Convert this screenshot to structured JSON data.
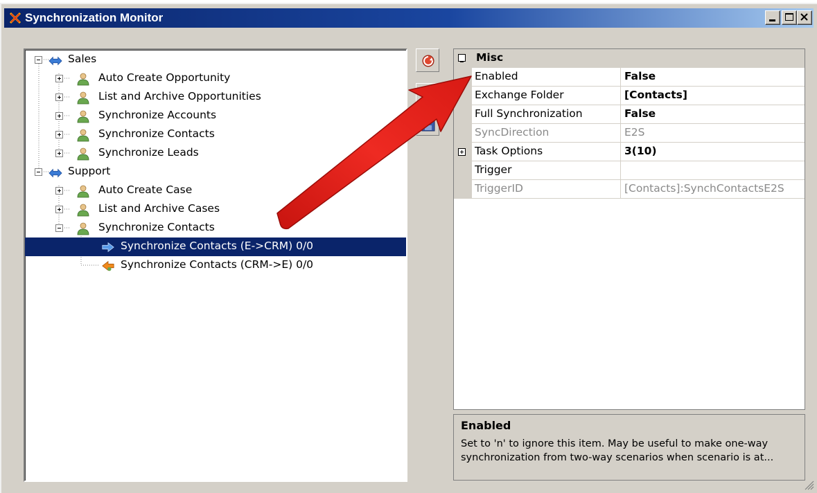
{
  "window": {
    "title": "Synchronization Monitor"
  },
  "tree": {
    "groups": [
      {
        "label": "Sales",
        "items": [
          {
            "label": "Auto Create Opportunity"
          },
          {
            "label": "List and Archive Opportunities"
          },
          {
            "label": "Synchronize Accounts"
          },
          {
            "label": "Synchronize Contacts"
          },
          {
            "label": "Synchronize Leads"
          }
        ]
      },
      {
        "label": "Support",
        "items": [
          {
            "label": "Auto Create Case"
          },
          {
            "label": "List and Archive Cases"
          },
          {
            "label": "Synchronize Contacts",
            "children": [
              {
                "label": "Synchronize Contacts (E->CRM) 0/0",
                "selected": true
              },
              {
                "label": "Synchronize Contacts (CRM->E) 0/0"
              }
            ]
          }
        ]
      }
    ]
  },
  "toolbar": {
    "buttons": [
      "run-icon",
      "view-icon",
      "save-icon"
    ]
  },
  "properties": {
    "category": "Misc",
    "rows": [
      {
        "name": "Enabled",
        "value": "False",
        "bold": true,
        "disabled": false
      },
      {
        "name": "Exchange Folder",
        "value": "[Contacts]",
        "bold": true,
        "disabled": false
      },
      {
        "name": "Full Synchronization",
        "value": "False",
        "bold": true,
        "disabled": false
      },
      {
        "name": "SyncDirection",
        "value": "E2S",
        "bold": false,
        "disabled": true
      },
      {
        "name": "Task Options",
        "value": "3(10)",
        "bold": true,
        "disabled": false,
        "expandable": true
      },
      {
        "name": "Trigger",
        "value": "",
        "bold": false,
        "disabled": false
      },
      {
        "name": "TriggerID",
        "value": "[Contacts]:SynchContactsE2S",
        "bold": false,
        "disabled": true
      }
    ]
  },
  "description": {
    "title": "Enabled",
    "text": "Set to 'n' to ignore this item. May be useful to make one-way synchronization from two-way scenarios when scenario is at..."
  },
  "colors": {
    "selection": "#0a246a",
    "annotation_arrow": "#e8261e"
  }
}
